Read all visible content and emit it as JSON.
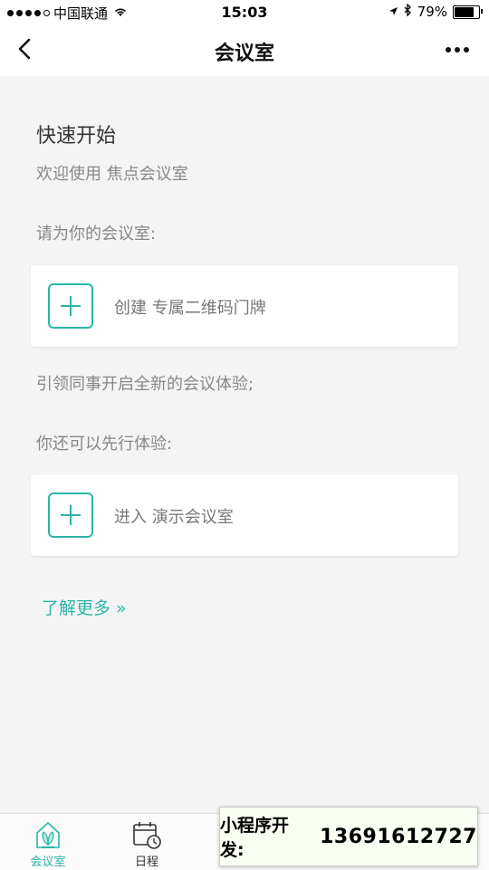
{
  "status_bar": {
    "carrier": "中国联通",
    "time": "15:03",
    "battery": "79%",
    "battery_level": 0.79
  },
  "nav": {
    "title": "会议室",
    "back_icon": "chevron-left-icon",
    "more_icon": "more-horizontal-icon"
  },
  "content": {
    "section_title": "快速开始",
    "welcome": "欢迎使用 焦点会议室",
    "prompt_create": "请为你的会议室:",
    "create_card_label": "创建 专属二维码门牌",
    "prompt_lead": "引领同事开启全新的会议体验;",
    "prompt_try": "你还可以先行体验:",
    "demo_card_label": "进入 演示会议室",
    "learn_more": "了解更多 »"
  },
  "tab_bar": {
    "tabs": [
      {
        "label": "会议室",
        "icon": "meeting-room-icon",
        "active": true
      },
      {
        "label": "日程",
        "icon": "calendar-clock-icon",
        "active": false
      }
    ]
  },
  "overlay": {
    "label": "小程序开发:",
    "phone": "13691612727"
  },
  "colors": {
    "accent": "#2bb5a6",
    "background": "#f4f4f4"
  }
}
